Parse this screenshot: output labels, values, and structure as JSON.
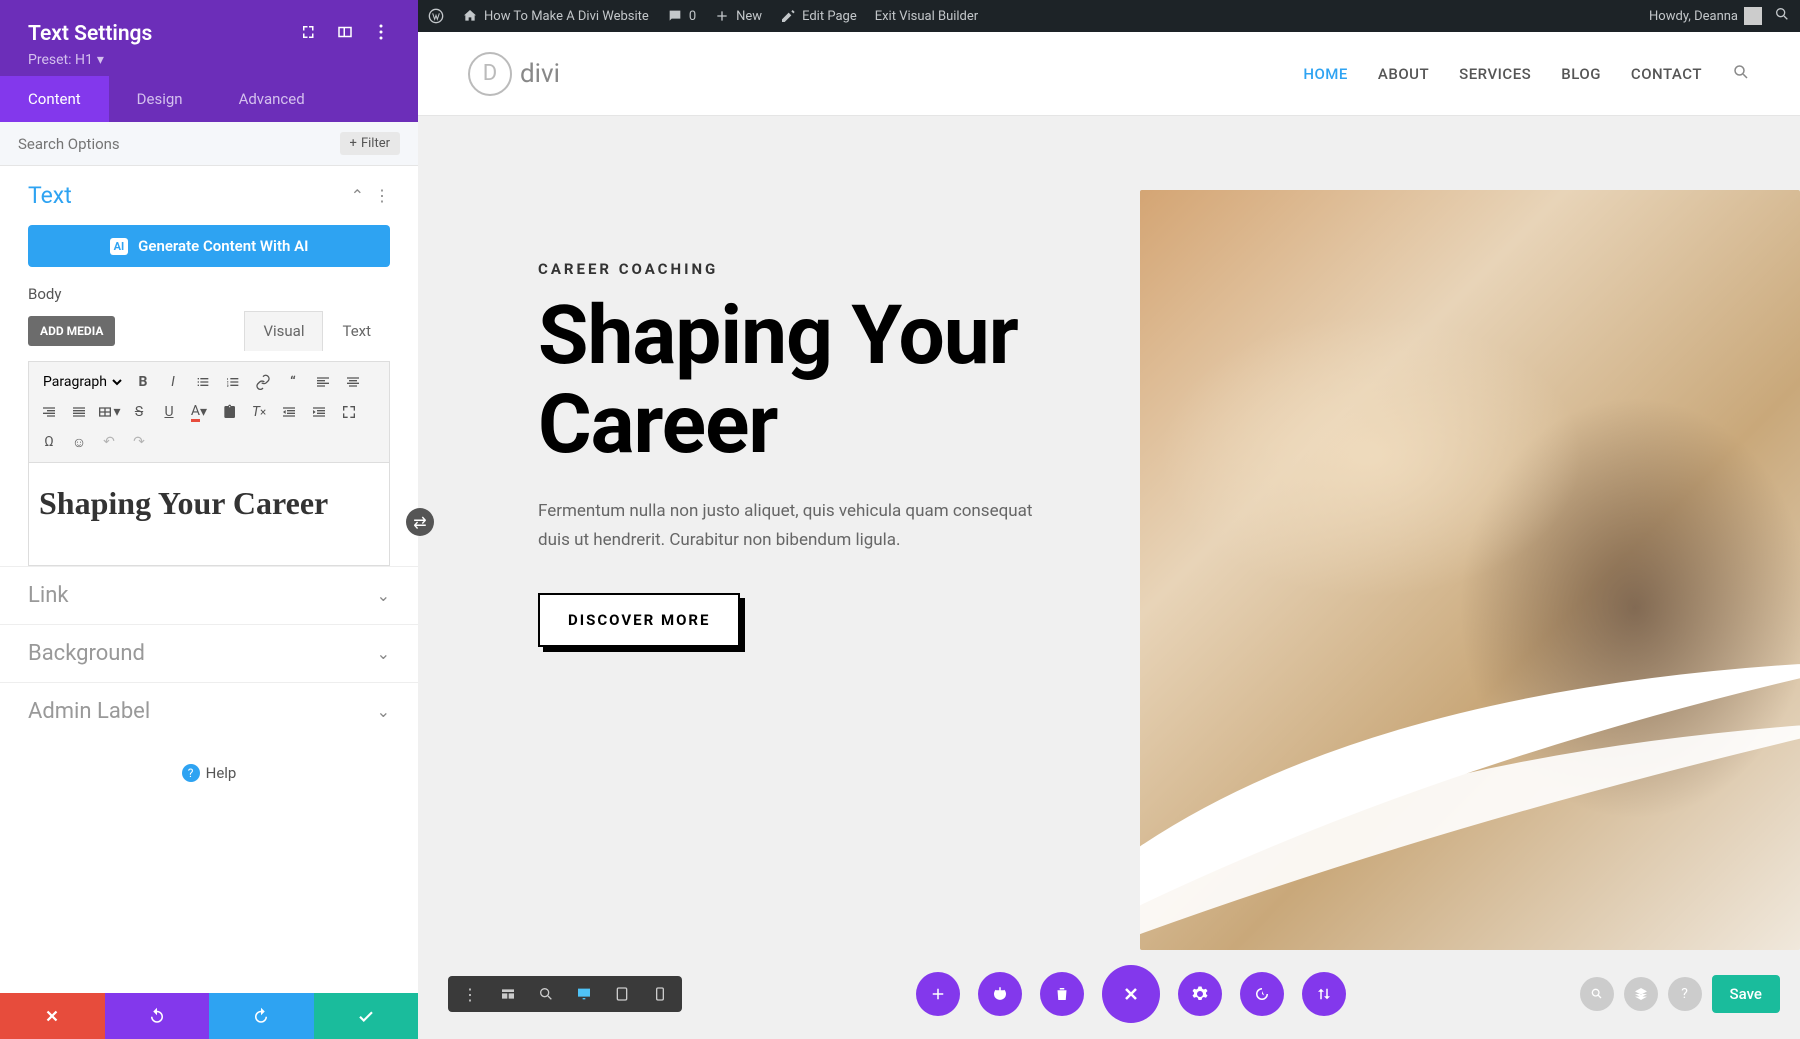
{
  "wpbar": {
    "site_title": "How To Make A Divi Website",
    "comments": "0",
    "new": "New",
    "edit_page": "Edit Page",
    "exit_vb": "Exit Visual Builder",
    "greeting": "Howdy, Deanna"
  },
  "sidebar": {
    "title": "Text Settings",
    "preset": "Preset: H1",
    "tabs": {
      "content": "Content",
      "design": "Design",
      "advanced": "Advanced"
    },
    "search_placeholder": "Search Options",
    "filter": "Filter",
    "section_text": "Text",
    "ai_button": "Generate Content With AI",
    "ai_badge": "AI",
    "body_label": "Body",
    "add_media": "ADD MEDIA",
    "ed_visual": "Visual",
    "ed_text": "Text",
    "format_sel": "Paragraph",
    "editor_content": "Shaping Your Career",
    "sec_link": "Link",
    "sec_background": "Background",
    "sec_admin": "Admin Label",
    "help": "Help"
  },
  "nav": {
    "items": [
      {
        "label": "HOME",
        "active": true
      },
      {
        "label": "ABOUT",
        "active": false
      },
      {
        "label": "SERVICES",
        "active": false
      },
      {
        "label": "BLOG",
        "active": false
      },
      {
        "label": "CONTACT",
        "active": false
      }
    ],
    "logo_text": "divi"
  },
  "hero": {
    "eyebrow": "CAREER COACHING",
    "h1": "Shaping Your Career",
    "p": "Fermentum nulla non justo aliquet, quis vehicula quam consequat duis ut hendrerit. Curabitur non bibendum ligula.",
    "cta": "DISCOVER MORE"
  },
  "bottombar": {
    "save": "Save"
  }
}
